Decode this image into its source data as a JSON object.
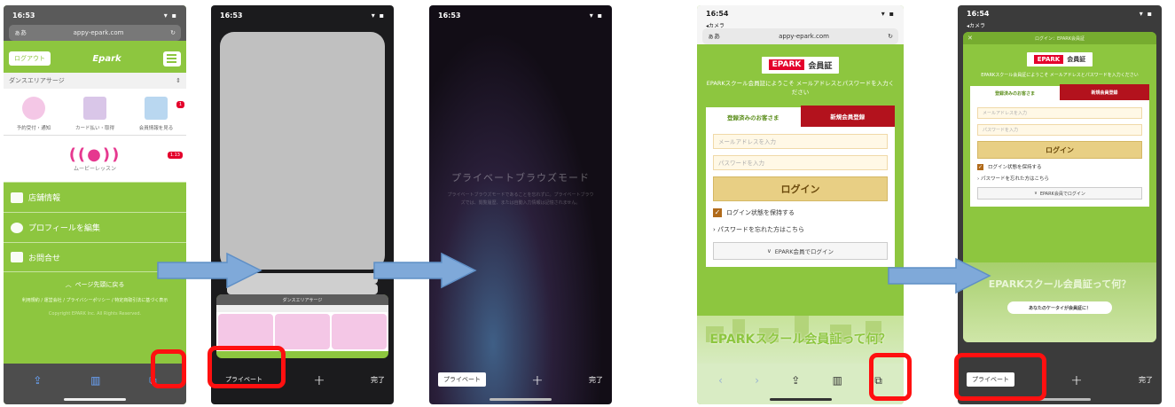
{
  "phone1": {
    "time": "16:53",
    "signal": "▾ ▪",
    "url": "appy-epark.com",
    "url_left": "ぁあ",
    "reload": "↻",
    "header_button": "ログアウト",
    "logo_text": "Epark",
    "breadcrumb": "ダンスエリアサージ",
    "grid_items": [
      "予約受付・通知",
      "カード払い・取得",
      "会員情報を見る"
    ],
    "lesson_label": "ムービーレッスン",
    "lesson_badge": "1.13",
    "menu_items": [
      "店舗情報",
      "プロフィールを編集",
      "お問合せ"
    ],
    "page_top": "ページ先頭に戻る",
    "footer_links": "利用規約 / 運営会社 / プライバシーポリシー / 特定商取引法に基づく表示",
    "copyright": "Copyright EPARK Inc. All Rights Reserved."
  },
  "phone2": {
    "time": "16:53",
    "thumb_title": "ダンスエリアサージ",
    "private_button": "プライベート",
    "plus": "+",
    "done": "完了"
  },
  "phone3": {
    "time": "16:53",
    "title": "プライベートブラウズモード",
    "description": "プライベートブラウズモードであることを忘れずに。プライベートブラウズでは、閲覧履歴、または自動入力情報は記憶されません。",
    "private_button": "プライベート",
    "plus": "+",
    "done": "完了"
  },
  "phone4": {
    "time": "16:54",
    "back_label": "◂カメラ",
    "url_left": "ぁあ",
    "url": "appy-epark.com",
    "logo_epark": "EPARK",
    "logo_kaiin": "会員証",
    "intro": "EPARKスクール会員証にようこそ メールアドレスとパスワードを入力ください",
    "tab_registered": "登録済みのお客さま",
    "tab_new": "新規会員登録",
    "email_placeholder": "メールアドレスを入力",
    "password_placeholder": "パスワードを入力",
    "login_button": "ログイン",
    "keep_login": "ログイン状態を保持する",
    "forgot": "パスワードを忘れた方はこちら",
    "epark_login": "EPARK会員でログイン",
    "banner": "EPARKスクール会員証って何？"
  },
  "phone5": {
    "time": "16:54",
    "back_label": "◂カメラ",
    "overlay_title": "ログイン：EPARK会員証",
    "banner": "EPARKスクール会員証って何？",
    "pill": "あなたのケータイが会員証に！",
    "private_button": "プライベート",
    "plus": "+",
    "done": "完了"
  },
  "colors": {
    "brand_green": "#8dc63f",
    "highlight_red": "#ff1010",
    "arrow_blue": "#7fa9d9",
    "epark_red": "#e4002b"
  }
}
